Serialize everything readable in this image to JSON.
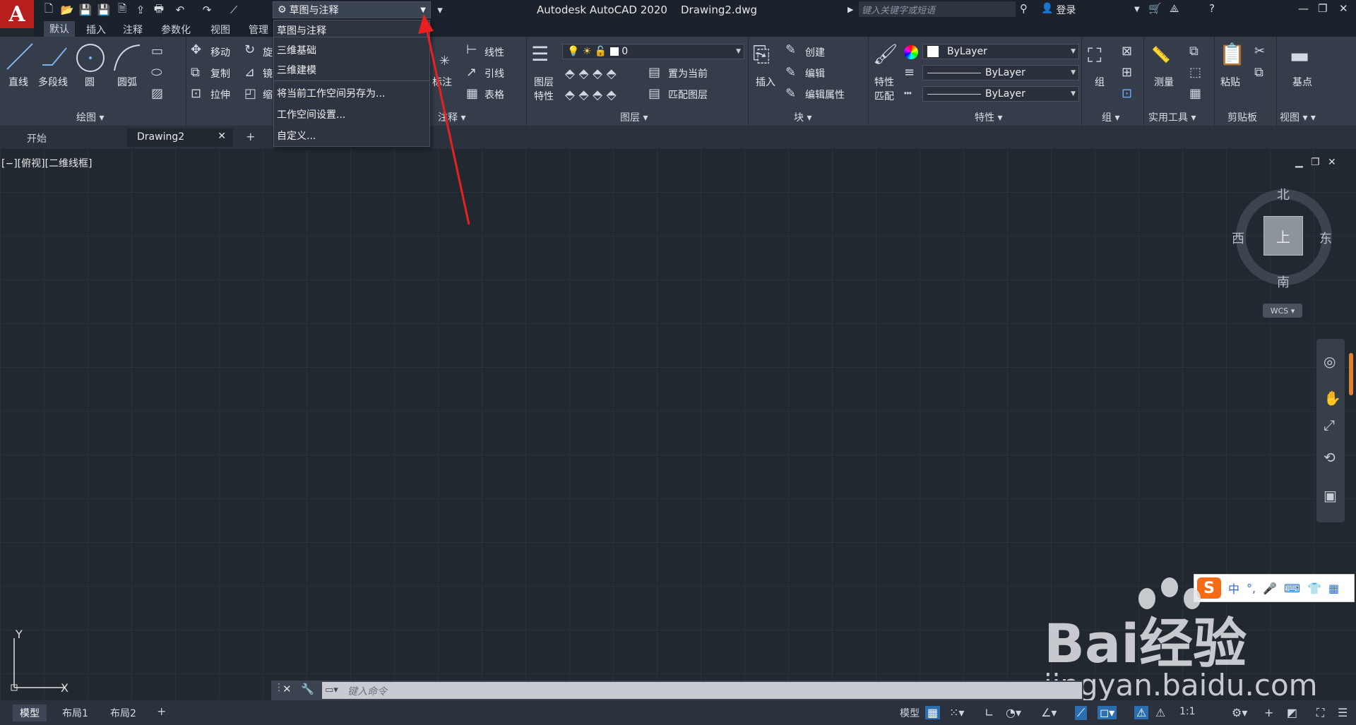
{
  "app": {
    "title": "Autodesk AutoCAD 2020",
    "file": "Drawing2.dwg",
    "logo": "A"
  },
  "workspace": {
    "current": "草图与注释",
    "menu": [
      "草图与注释",
      "三维基础",
      "三维建模",
      "将当前工作空间另存为...",
      "工作空间设置...",
      "自定义..."
    ]
  },
  "search": {
    "placeholder": "键入关键字或短语"
  },
  "login": {
    "label": "登录"
  },
  "ribbon_tabs": [
    "默认",
    "插入",
    "注释",
    "参数化",
    "视图",
    "管理"
  ],
  "draw": {
    "title": "绘图",
    "items": [
      "直线",
      "多段线",
      "圆",
      "圆弧"
    ]
  },
  "modify": {
    "items": [
      "移动",
      "复制",
      "拉伸"
    ],
    "partial": [
      "旋",
      "镜",
      "缩"
    ]
  },
  "annotation": {
    "title": "注释",
    "items": [
      "线性",
      "引线",
      "表格"
    ],
    "dim": "标注"
  },
  "layers": {
    "title": "图层",
    "current_layer": "0",
    "items": [
      "置为当前",
      "匹配图层"
    ],
    "big": [
      "图层",
      "特性"
    ]
  },
  "block": {
    "title": "块",
    "insert": "插入",
    "items": [
      "创建",
      "编辑",
      "编辑属性"
    ]
  },
  "properties": {
    "title": "特性",
    "match": [
      "特性",
      "匹配"
    ],
    "color": "ByLayer",
    "linetype": "ByLayer",
    "lineweight": "ByLayer"
  },
  "groups": {
    "title": "组",
    "label": "组"
  },
  "utilities": {
    "title": "实用工具",
    "label": "测量"
  },
  "clipboard": {
    "title": "剪贴板",
    "label": "粘贴"
  },
  "viewp": {
    "title": "视图",
    "label": "基点"
  },
  "file_tabs": [
    "开始",
    "Drawing2"
  ],
  "viewport_label": "[−][俯视][二维线框]",
  "viewcube": {
    "n": "北",
    "s": "南",
    "e": "东",
    "w": "西",
    "top": "上",
    "wcs": "WCS"
  },
  "ucs": {
    "x": "X",
    "y": "Y"
  },
  "command": {
    "placeholder": "键入命令"
  },
  "layout_tabs": [
    "模型",
    "布局1",
    "布局2"
  ],
  "status": {
    "model": "模型",
    "scale": "1:1"
  },
  "ime": {
    "logo": "S",
    "lang": "中"
  },
  "watermark": {
    "brand": "Bai经验",
    "url": "jingyan.baidu.com"
  }
}
